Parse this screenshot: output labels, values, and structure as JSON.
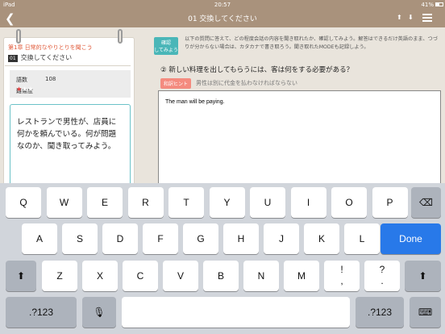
{
  "status_bar": {
    "device": "iPad",
    "time": "20:57",
    "battery": "41%"
  },
  "nav": {
    "back_icon": "chevron-left",
    "title": "01 交換してください",
    "up_icon": "⬆",
    "down_icon": "⬇",
    "menu_icon": "hamburger"
  },
  "card": {
    "chapter": "第1章 日常的なやりとりを聞こう",
    "lesson_number": "01",
    "lesson_title": "交換してください",
    "word_count_label": "語数",
    "word_count": "108",
    "difficulty_label": "難易度",
    "difficulty": 1,
    "difficulty_max": 3,
    "scenario": "レストランで男性が、店員に何かを頼んでいる。何が問題なのか、聞き取ってみよう。"
  },
  "panel": {
    "check_badge_line1": "確認",
    "check_badge_line2": "してみよう",
    "instructions": "以下の質問に答えて、どの程度会話の内容を聞き取れたか、確認してみよう。解答はできるだけ英語のまま、つづりが分からない場合は、カタカナで書き取ろう。聞き取れたMODEも記録しよう。",
    "question": "② 新しい料理を出してもらうには、客は何をする必要がある？",
    "hint_label": "和訳ヒント",
    "hint_text": "男性は別に代金を払わなければならない",
    "answer_value": "The man will be paying."
  },
  "keyboard": {
    "row1": [
      "Q",
      "W",
      "E",
      "R",
      "T",
      "Y",
      "U",
      "I",
      "O",
      "P"
    ],
    "row2": [
      "A",
      "S",
      "D",
      "F",
      "G",
      "H",
      "J",
      "K",
      "L"
    ],
    "row3": [
      "Z",
      "X",
      "C",
      "V",
      "B",
      "N",
      "M"
    ],
    "row3_punct": [
      {
        "top": "!",
        "bottom": ","
      },
      {
        "top": "?",
        "bottom": "."
      }
    ],
    "done_label": "Done",
    "num_label": ".?123",
    "delete_icon": "⌫",
    "shift_icon": "⬆",
    "mic_icon": "🎙",
    "hide_icon": "⌨"
  }
}
